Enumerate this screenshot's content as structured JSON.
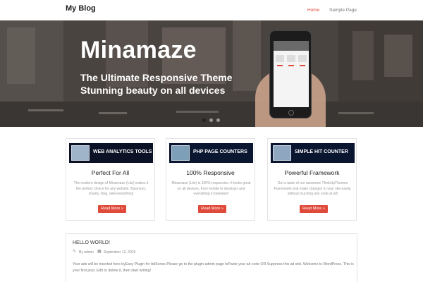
{
  "header": {
    "site_title": "My Blog",
    "nav": [
      {
        "label": "Home",
        "active": true
      },
      {
        "label": "Sample Page",
        "active": false
      }
    ],
    "accent_color": "#e04a3b"
  },
  "hero": {
    "title": "Minamaze",
    "subtitle_line1": "The Ultimate Responsive Theme",
    "subtitle_line2": "Stunning beauty on all devices",
    "slides": 3,
    "active_slide": 1
  },
  "features": [
    {
      "banner_text": "WEB ANALYTICS TOOLS",
      "title": "Perfect For All",
      "text": "The modern design of Minamaze (Lite) makes it the perfect choice for any website. Business, charity, blog, well everything!",
      "button": "Read More »"
    },
    {
      "banner_text": "PHP PAGE COUNTERS",
      "title": "100% Responsive",
      "text": "Minamaze (Lite) is 100% responsive. It looks great on all devices, from mobile to desktops and everything in between!",
      "button": "Read More »"
    },
    {
      "banner_text": "SIMPLE HIT COUNTER",
      "title": "Powerful Framework",
      "text": "Get a taste of our awesome ThinkUpThemes Framework and make changes to your site easily, without touching any code at all!",
      "button": "Read More »"
    }
  ],
  "post": {
    "title": "HELLO WORLD!",
    "author": "By admin",
    "date": "September 12, 2015",
    "author_icon": "pencil-icon",
    "date_icon": "calendar-icon",
    "text": "Your ads will be inserted here byEasy Plugin for AdSense.Please go to the plugin admin page toPaste your ad code OR Suppress this ad slot. Welcome to WordPress. This is your first post. Edit or delete it, then start writing!"
  }
}
